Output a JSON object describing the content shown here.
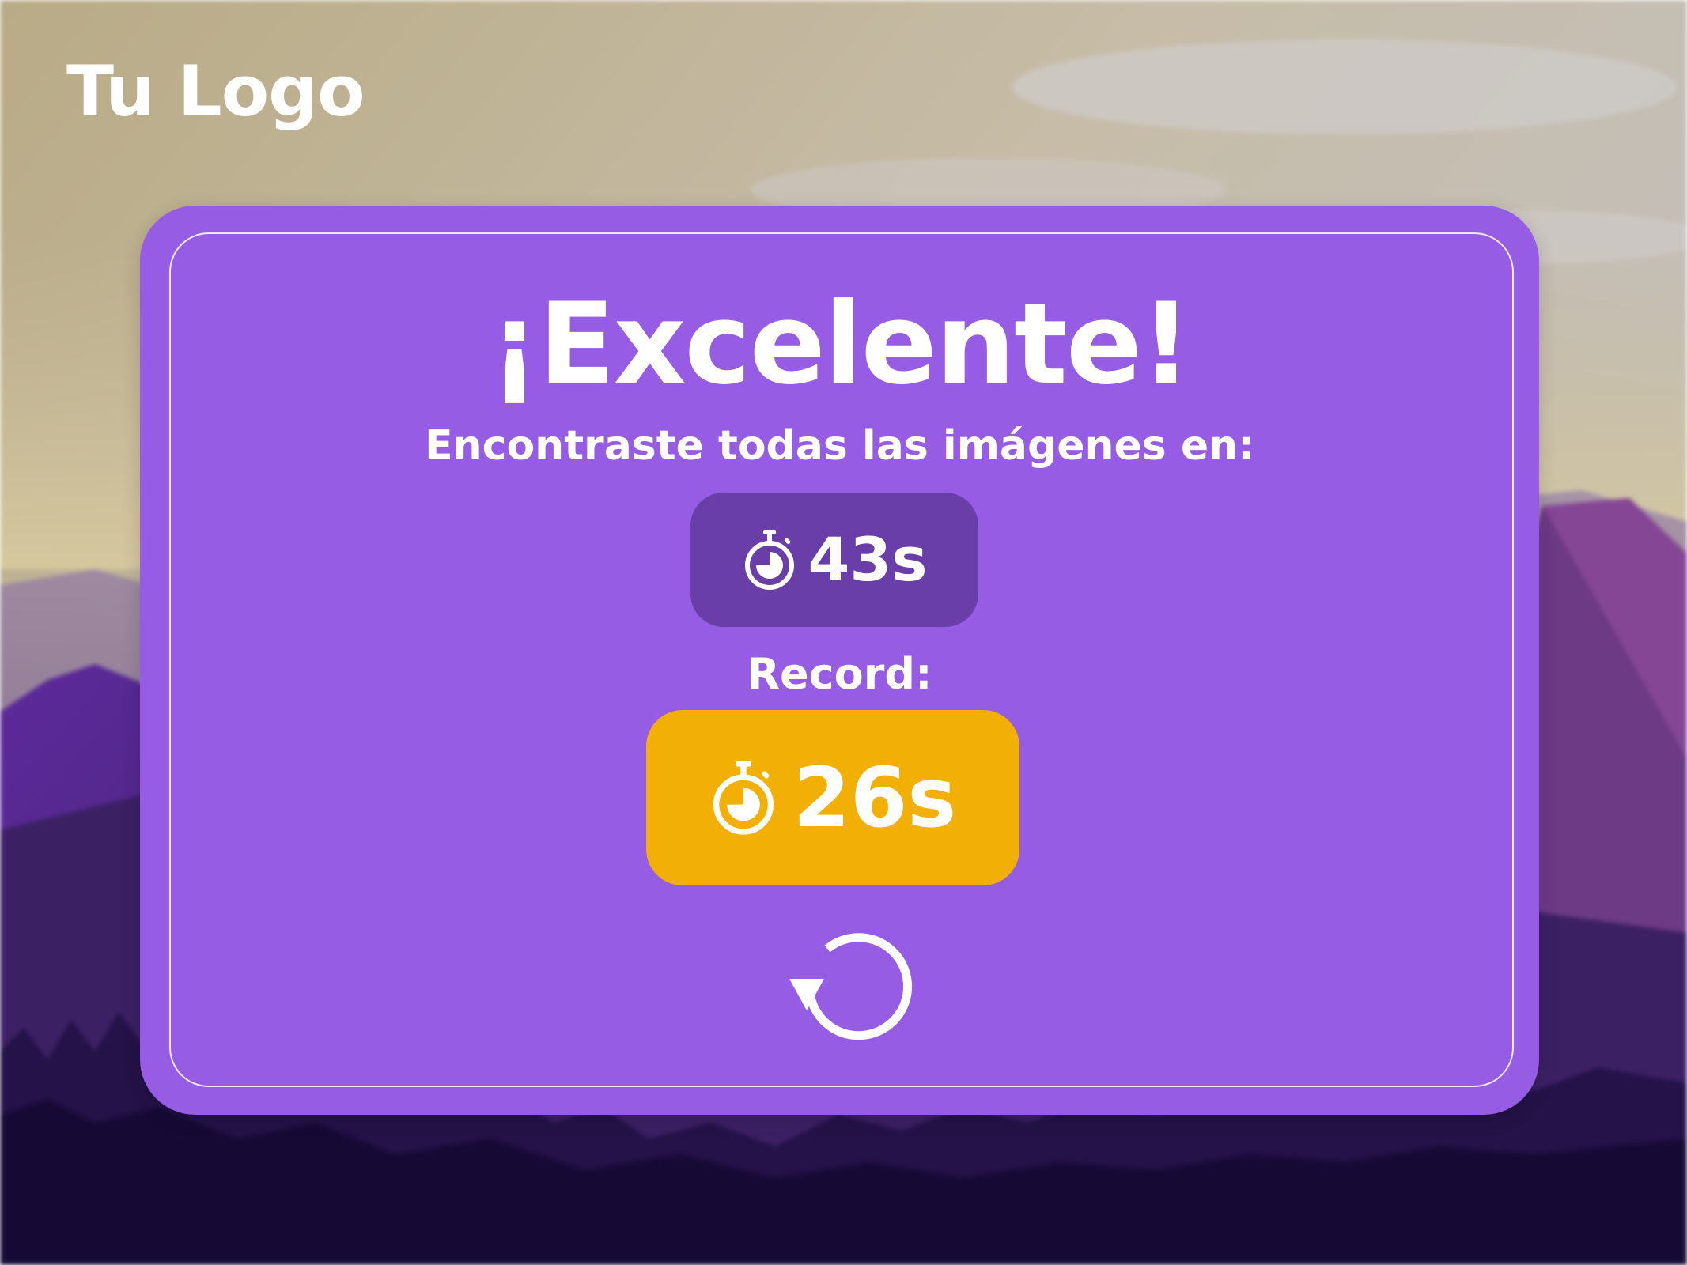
{
  "logo": {
    "text": "Tu Logo"
  },
  "panel": {
    "title": "¡Excelente!",
    "subtitle": "Encontraste todas las imágenes en:",
    "time": {
      "icon": "stopwatch-icon",
      "value": "43s"
    },
    "record_label": "Record:",
    "record": {
      "icon": "stopwatch-icon",
      "value": "26s"
    },
    "replay": {
      "icon": "replay-icon"
    }
  },
  "colors": {
    "panel": "#965ce4",
    "time_badge": "#6a3ea8",
    "record_badge": "#f2b007",
    "text": "#ffffff",
    "sky_top": "#c2bba3",
    "mountain": "#6e3b8f",
    "forest": "#160a35"
  }
}
